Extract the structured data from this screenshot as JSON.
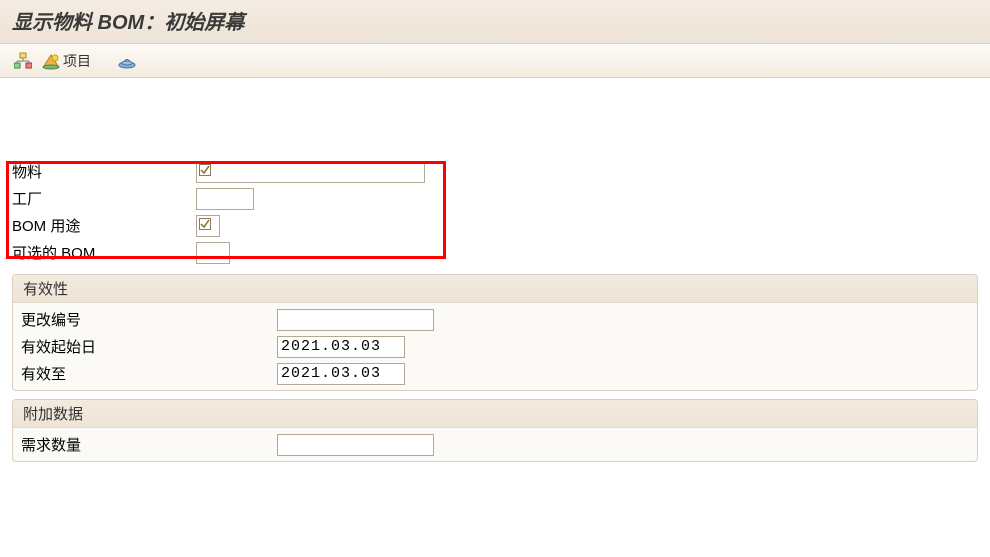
{
  "header": {
    "title": "显示物料 BOM：初始屏幕"
  },
  "toolbar": {
    "items_label": "项目"
  },
  "form_top": {
    "material_label": "物料",
    "material_value": "",
    "plant_label": "工厂",
    "plant_value": "",
    "bom_use_label": "BOM 用途",
    "bom_use_value": "",
    "optional_bom_label": "可选的 BOM",
    "optional_bom_value": ""
  },
  "group_validity": {
    "title": "有效性",
    "change_num_label": "更改编号",
    "change_num_value": "",
    "valid_from_label": "有效起始日",
    "valid_from_value": "2021.03.03",
    "valid_to_label": "有效至",
    "valid_to_value": "2021.03.03"
  },
  "group_additional": {
    "title": "附加数据",
    "req_qty_label": "需求数量",
    "req_qty_value": ""
  }
}
